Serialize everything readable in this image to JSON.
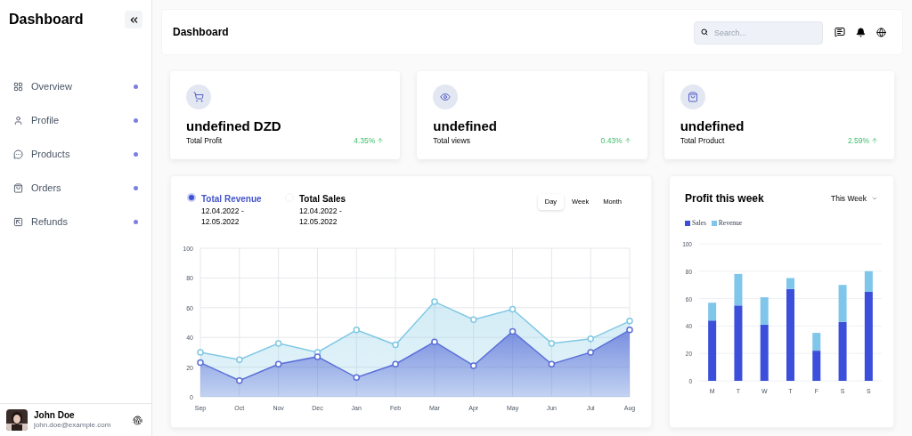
{
  "sidebar": {
    "title": "Dashboard",
    "items": [
      {
        "label": "Overview"
      },
      {
        "label": "Profile"
      },
      {
        "label": "Products"
      },
      {
        "label": "Orders"
      },
      {
        "label": "Refunds"
      }
    ],
    "user": {
      "name": "John Doe",
      "email": "john.doe@example.com"
    }
  },
  "header": {
    "title": "Dashboard",
    "search": {
      "placeholder": "Search..."
    }
  },
  "stats": [
    {
      "value": "undefined DZD",
      "label": "Total Profit",
      "change": "4.35%"
    },
    {
      "value": "undefined",
      "label": "Total views",
      "change": "0.43%"
    },
    {
      "value": "undefined",
      "label": "Total Product",
      "change": "2.59%"
    }
  ],
  "revenue_card": {
    "toggles": [
      {
        "label": "Total Revenue",
        "dates": "12.04.2022 - 12.05.2022",
        "selected": true
      },
      {
        "label": "Total Sales",
        "dates": "12.04.2022 - 12.05.2022",
        "selected": false
      }
    ],
    "periods": [
      {
        "label": "Day",
        "selected": true
      },
      {
        "label": "Week",
        "selected": false
      },
      {
        "label": "Month",
        "selected": false
      }
    ],
    "chart_data": {
      "type": "area",
      "grid": true,
      "x": [
        "Sep",
        "Oct",
        "Nov",
        "Dec",
        "Jan",
        "Feb",
        "Mar",
        "Apr",
        "May",
        "Jun",
        "Jul",
        "Aug"
      ],
      "ylim": [
        0,
        100
      ],
      "yticks": [
        0,
        20,
        40,
        60,
        80,
        100
      ],
      "series": [
        {
          "color": "#5a6fd8",
          "values": [
            23,
            11,
            22,
            27,
            13,
            22,
            37,
            21,
            44,
            22,
            30,
            45
          ]
        },
        {
          "color": "#80c8e4",
          "values": [
            30,
            25,
            36,
            30,
            45,
            35,
            64,
            52,
            59,
            36,
            39,
            51
          ]
        }
      ]
    }
  },
  "profit_card": {
    "title": "Profit this week",
    "period": "This Week",
    "chart_data": {
      "type": "bar",
      "grid": true,
      "stacked": true,
      "categories": [
        "M",
        "T",
        "W",
        "T",
        "F",
        "S",
        "S"
      ],
      "ylim": [
        0,
        100
      ],
      "yticks": [
        0,
        20,
        40,
        60,
        80,
        100
      ],
      "series": [
        {
          "name": "Sales",
          "color": "#3b4fdb",
          "values": [
            44,
            55,
            41,
            67,
            22,
            43,
            65
          ]
        },
        {
          "name": "Revenue",
          "color": "#7fc6ea",
          "values": [
            13,
            23,
            20,
            8,
            13,
            27,
            15
          ]
        }
      ]
    }
  }
}
